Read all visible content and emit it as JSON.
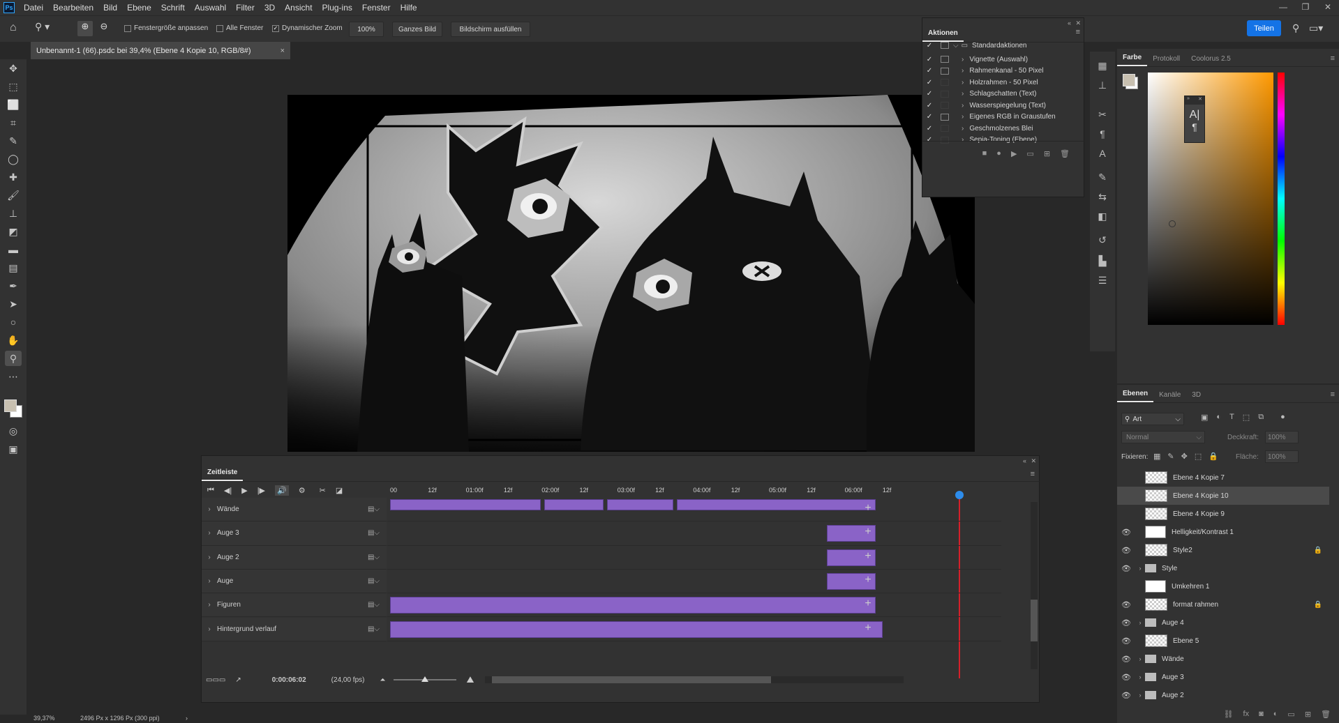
{
  "menubar": {
    "logo": "Ps",
    "items": [
      "Datei",
      "Bearbeiten",
      "Bild",
      "Ebene",
      "Schrift",
      "Auswahl",
      "Filter",
      "3D",
      "Ansicht",
      "Plug-ins",
      "Fenster",
      "Hilfe"
    ]
  },
  "options": {
    "fit_window": "Fenstergröße anpassen",
    "all_windows": "Alle Fenster",
    "dynamic_zoom": "Dynamischer Zoom",
    "zoom_value": "100%",
    "fit_screen": "Ganzes Bild",
    "fill_screen": "Bildschirm ausfüllen",
    "share": "Teilen"
  },
  "document": {
    "tab_title": "Unbenannt-1 (66).psdc bei 39,4% (Ebene 4 Kopie 10, RGB/8#)",
    "close": "×"
  },
  "actions_panel": {
    "tab": "Aktionen",
    "set_name": "Standardaktionen",
    "actions": [
      {
        "name": "Vignette (Auswahl)",
        "dialog": true
      },
      {
        "name": "Rahmenkanal - 50 Pixel",
        "dialog": true
      },
      {
        "name": "Holzrahmen - 50 Pixel",
        "dialog": false
      },
      {
        "name": "Schlagschatten (Text)",
        "dialog": false
      },
      {
        "name": "Wasserspiegelung (Text)",
        "dialog": false
      },
      {
        "name": "Eigenes RGB in Graustufen",
        "dialog": true
      },
      {
        "name": "Geschmolzenes Blei",
        "dialog": false
      },
      {
        "name": "Sepia-Toning (Ebene)",
        "dialog": false
      }
    ]
  },
  "color_panel": {
    "tabs": [
      "Farbe",
      "Protokoll",
      "Coolorus 2.5"
    ],
    "hue_color": "#ff9900"
  },
  "layers_panel": {
    "tabs": [
      "Ebenen",
      "Kanäle",
      "3D"
    ],
    "filter": "Art",
    "blend_mode": "Normal",
    "opacity_label": "Deckkraft:",
    "opacity_value": "100%",
    "lock_label": "Fixieren:",
    "fill_label": "Fläche:",
    "fill_value": "100%",
    "layers": [
      {
        "name": "Ebene 4 Kopie 7",
        "visible": false,
        "type": "checker"
      },
      {
        "name": "Ebene 4 Kopie 10",
        "visible": false,
        "type": "checker",
        "selected": true
      },
      {
        "name": "Ebene 4 Kopie 9",
        "visible": false,
        "type": "checker"
      },
      {
        "name": "Helligkeit/Kontrast 1",
        "visible": true,
        "type": "adjust"
      },
      {
        "name": "Style2",
        "visible": true,
        "type": "checker",
        "locked": true
      },
      {
        "name": "Style",
        "visible": true,
        "type": "folder"
      },
      {
        "name": "Umkehren 1",
        "visible": false,
        "type": "adjust"
      },
      {
        "name": "format rahmen",
        "visible": true,
        "type": "checker",
        "locked": true
      },
      {
        "name": "Auge 4",
        "visible": true,
        "type": "folder"
      },
      {
        "name": "Ebene 5",
        "visible": true,
        "type": "checker"
      },
      {
        "name": "Wände",
        "visible": true,
        "type": "folder"
      },
      {
        "name": "Auge 3",
        "visible": true,
        "type": "folder"
      },
      {
        "name": "Auge 2",
        "visible": true,
        "type": "folder"
      }
    ]
  },
  "timeline": {
    "tab": "Zeitleiste",
    "ruler": [
      "00",
      "12f",
      "01:00f",
      "12f",
      "02:00f",
      "12f",
      "03:00f",
      "12f",
      "04:00f",
      "12f",
      "05:00f",
      "12f",
      "06:00f",
      "12f"
    ],
    "tracks": [
      "Wände",
      "Auge 3",
      "Auge 2",
      "Auge",
      "Figuren",
      "Hintergrund verlauf"
    ],
    "current_time": "0:00:06:02",
    "fps": "(24,00 fps)",
    "clip_color": "#8a63c7"
  },
  "statusbar": {
    "zoom": "39,37%",
    "doc_size": "2496 Px x 1296 Px (300 ppi)"
  }
}
